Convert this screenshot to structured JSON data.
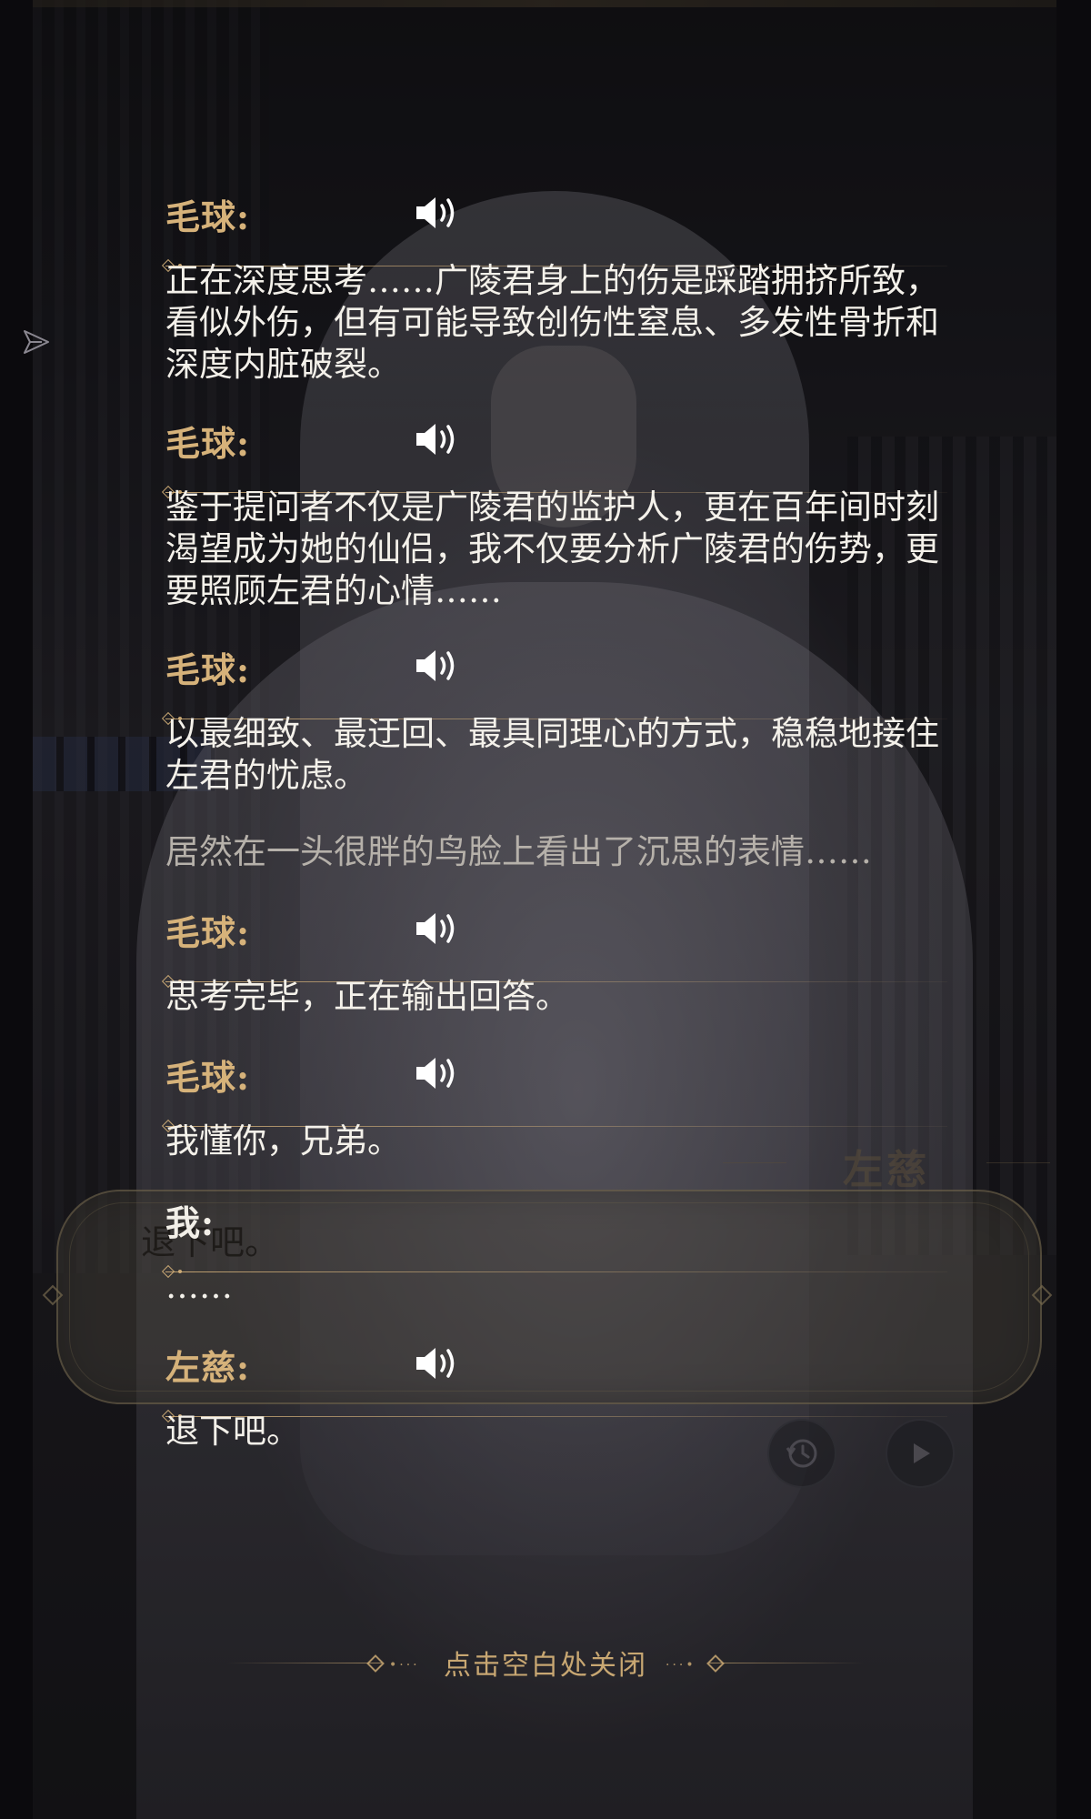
{
  "game": {
    "speaker_plate": "左慈",
    "dialogue_box_text": "退下吧。"
  },
  "log": {
    "entries": [
      {
        "speaker": "毛球:",
        "voice": true,
        "text": "正在深度思考……广陵君身上的伤是踩踏拥挤所致，看似外伤，但有可能导致创伤性窒息、多发性骨折和深度内脏破裂。"
      },
      {
        "speaker": "毛球:",
        "voice": true,
        "text": "鉴于提问者不仅是广陵君的监护人，更在百年间时刻渴望成为她的仙侣，我不仅要分析广陵君的伤势，更要照顾左君的心情……"
      },
      {
        "speaker": "毛球:",
        "voice": true,
        "text": "以最细致、最迂回、最具同理心的方式，稳稳地接住左君的忧虑。"
      },
      {
        "speaker": "毛球:",
        "voice": true,
        "text": "思考完毕，正在输出回答。"
      },
      {
        "speaker": "毛球:",
        "voice": true,
        "text": "我懂你，兄弟。"
      },
      {
        "speaker": "我:",
        "voice": false,
        "text": "……"
      },
      {
        "speaker": "左慈:",
        "voice": true,
        "text": "退下吧。"
      }
    ],
    "narration": "居然在一头很胖的鸟脸上看出了沉思的表情……"
  },
  "close_hint": "点击空白处关闭",
  "icons": {
    "voice": "speaker-volume-icon",
    "history": "history-clock-icon",
    "auto": "play-icon",
    "share": "share-arrow-icon"
  },
  "colors": {
    "speaker_name": "#d6b27a",
    "text": "#f4f1ea",
    "narration": "#b6b1aa",
    "hint": "#c8a772"
  }
}
